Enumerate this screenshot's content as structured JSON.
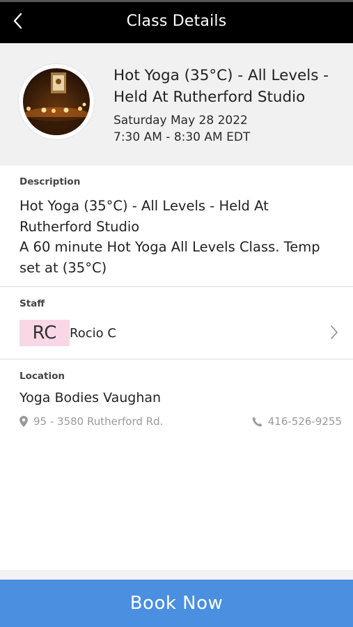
{
  "header": {
    "title": "Class Details",
    "back_icon": "chevron-left-icon"
  },
  "class_info": {
    "title": "Hot Yoga (35°C) - All Levels - Held At Rutherford Studio",
    "date": "Saturday May 28 2022",
    "time": "7:30 AM - 8:30 AM EDT"
  },
  "description": {
    "label": "Description",
    "line1": "Hot Yoga (35°C) - All Levels - Held At Rutherford Studio",
    "line2": "A 60 minute Hot Yoga All Levels Class. Temp set at (35°C)"
  },
  "staff": {
    "label": "Staff",
    "initials": "RC",
    "name": "Rocio C",
    "initials_bg": "#fad7e6"
  },
  "location": {
    "label": "Location",
    "name": "Yoga Bodies Vaughan",
    "address": "95 - 3580 Rutherford Rd.",
    "phone": "416-526-9255"
  },
  "actions": {
    "book_label": "Book Now",
    "accent": "#4a8fe0"
  }
}
